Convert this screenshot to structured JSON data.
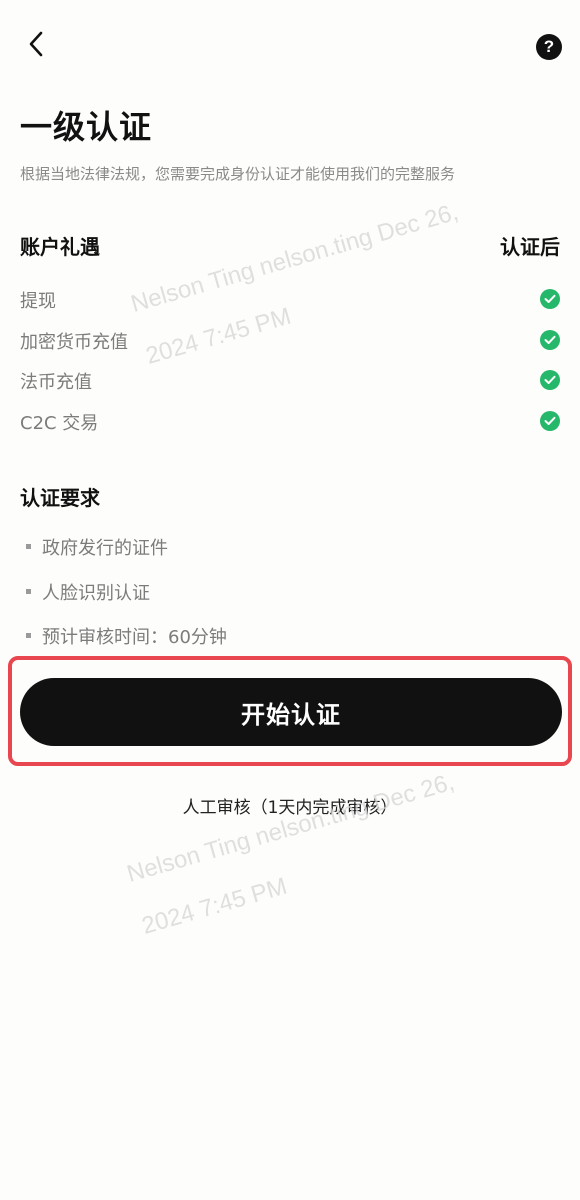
{
  "header": {
    "back_icon": "chevron-left-icon",
    "help_icon": "question-circle-icon",
    "help_glyph": "?"
  },
  "title": "一级认证",
  "subtitle": "根据当地法律法规，您需要完成身份认证才能使用我们的完整服务",
  "benefits": {
    "heading": "账户礼遇",
    "column_label": "认证后",
    "items": [
      {
        "label": "提现",
        "status_icon": "check-circle-icon"
      },
      {
        "label": "加密货币充值",
        "status_icon": "check-circle-icon"
      },
      {
        "label": "法币充值",
        "status_icon": "check-circle-icon"
      },
      {
        "label": "C2C 交易",
        "status_icon": "check-circle-icon"
      }
    ],
    "check_color": "#26b86a"
  },
  "requirements": {
    "heading": "认证要求",
    "items": [
      "政府发行的证件",
      "人脸识别认证",
      "预计审核时间：60分钟"
    ]
  },
  "cta": {
    "label": "开始认证",
    "highlight_color": "#e8474f"
  },
  "review_note": "人工审核（1天内完成审核）",
  "watermarks": [
    {
      "line1": "Nelson Ting nelson.ting Dec 26,",
      "line2": "2024 7:45 PM"
    },
    {
      "line1": "Nelson Ting nelson.ting Dec 26,",
      "line2": "2024 7:45 PM"
    }
  ]
}
